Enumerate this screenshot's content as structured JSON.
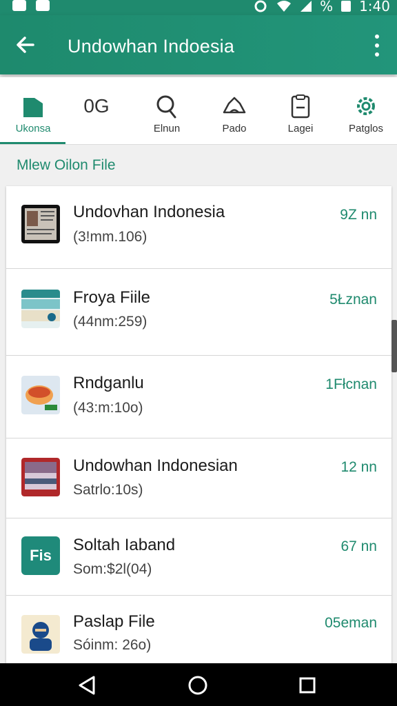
{
  "status_bar": {
    "time": "1:40",
    "battery": "%"
  },
  "app_bar": {
    "title": "Undowhan Indoesia"
  },
  "tabs": [
    {
      "label": "Ukonsa",
      "icon": "home-icon",
      "active": true
    },
    {
      "label": "",
      "glyph": "0G",
      "icon": "zoom-icon",
      "active": false
    },
    {
      "label": "Elnun",
      "icon": "search-icon",
      "active": false
    },
    {
      "label": "Pado",
      "icon": "cloud-icon",
      "active": false
    },
    {
      "label": "Lagei",
      "icon": "clipboard-icon",
      "active": false
    },
    {
      "label": "Patglos",
      "icon": "gear-icon",
      "active": false
    }
  ],
  "section": {
    "title": "Mlew Oilon File"
  },
  "files": [
    {
      "name": "Undovhan Indonesia",
      "sub": "(3!mm.106)",
      "meta": "9Z nn",
      "thumb": "tablet-thumbnail"
    },
    {
      "name": "Froya Fiile",
      "sub": "(44nm:259)",
      "meta": "5Łznan",
      "thumb": "beach-thumbnail"
    },
    {
      "name": "Rndganlu",
      "sub": "(43:m:10o)",
      "meta": "1Fłcnan",
      "thumb": "food-thumbnail"
    },
    {
      "name": "Undowhan Indonesian",
      "sub": "Satrlo:10s)",
      "meta": "12 nn",
      "thumb": "landscape-thumbnail"
    },
    {
      "name": "Soltah Iaband",
      "sub": "Som:$2l(04)",
      "meta": "67 nn",
      "thumb": "fis-thumbnail",
      "thumb_text": "Fis"
    },
    {
      "name": "Paslap File",
      "sub": "Sóinm: 26o)",
      "meta": "05eman",
      "thumb": "person-thumbnail"
    }
  ],
  "colors": {
    "primary": "#1f8a6e",
    "accent_text": "#1f8a6e"
  }
}
